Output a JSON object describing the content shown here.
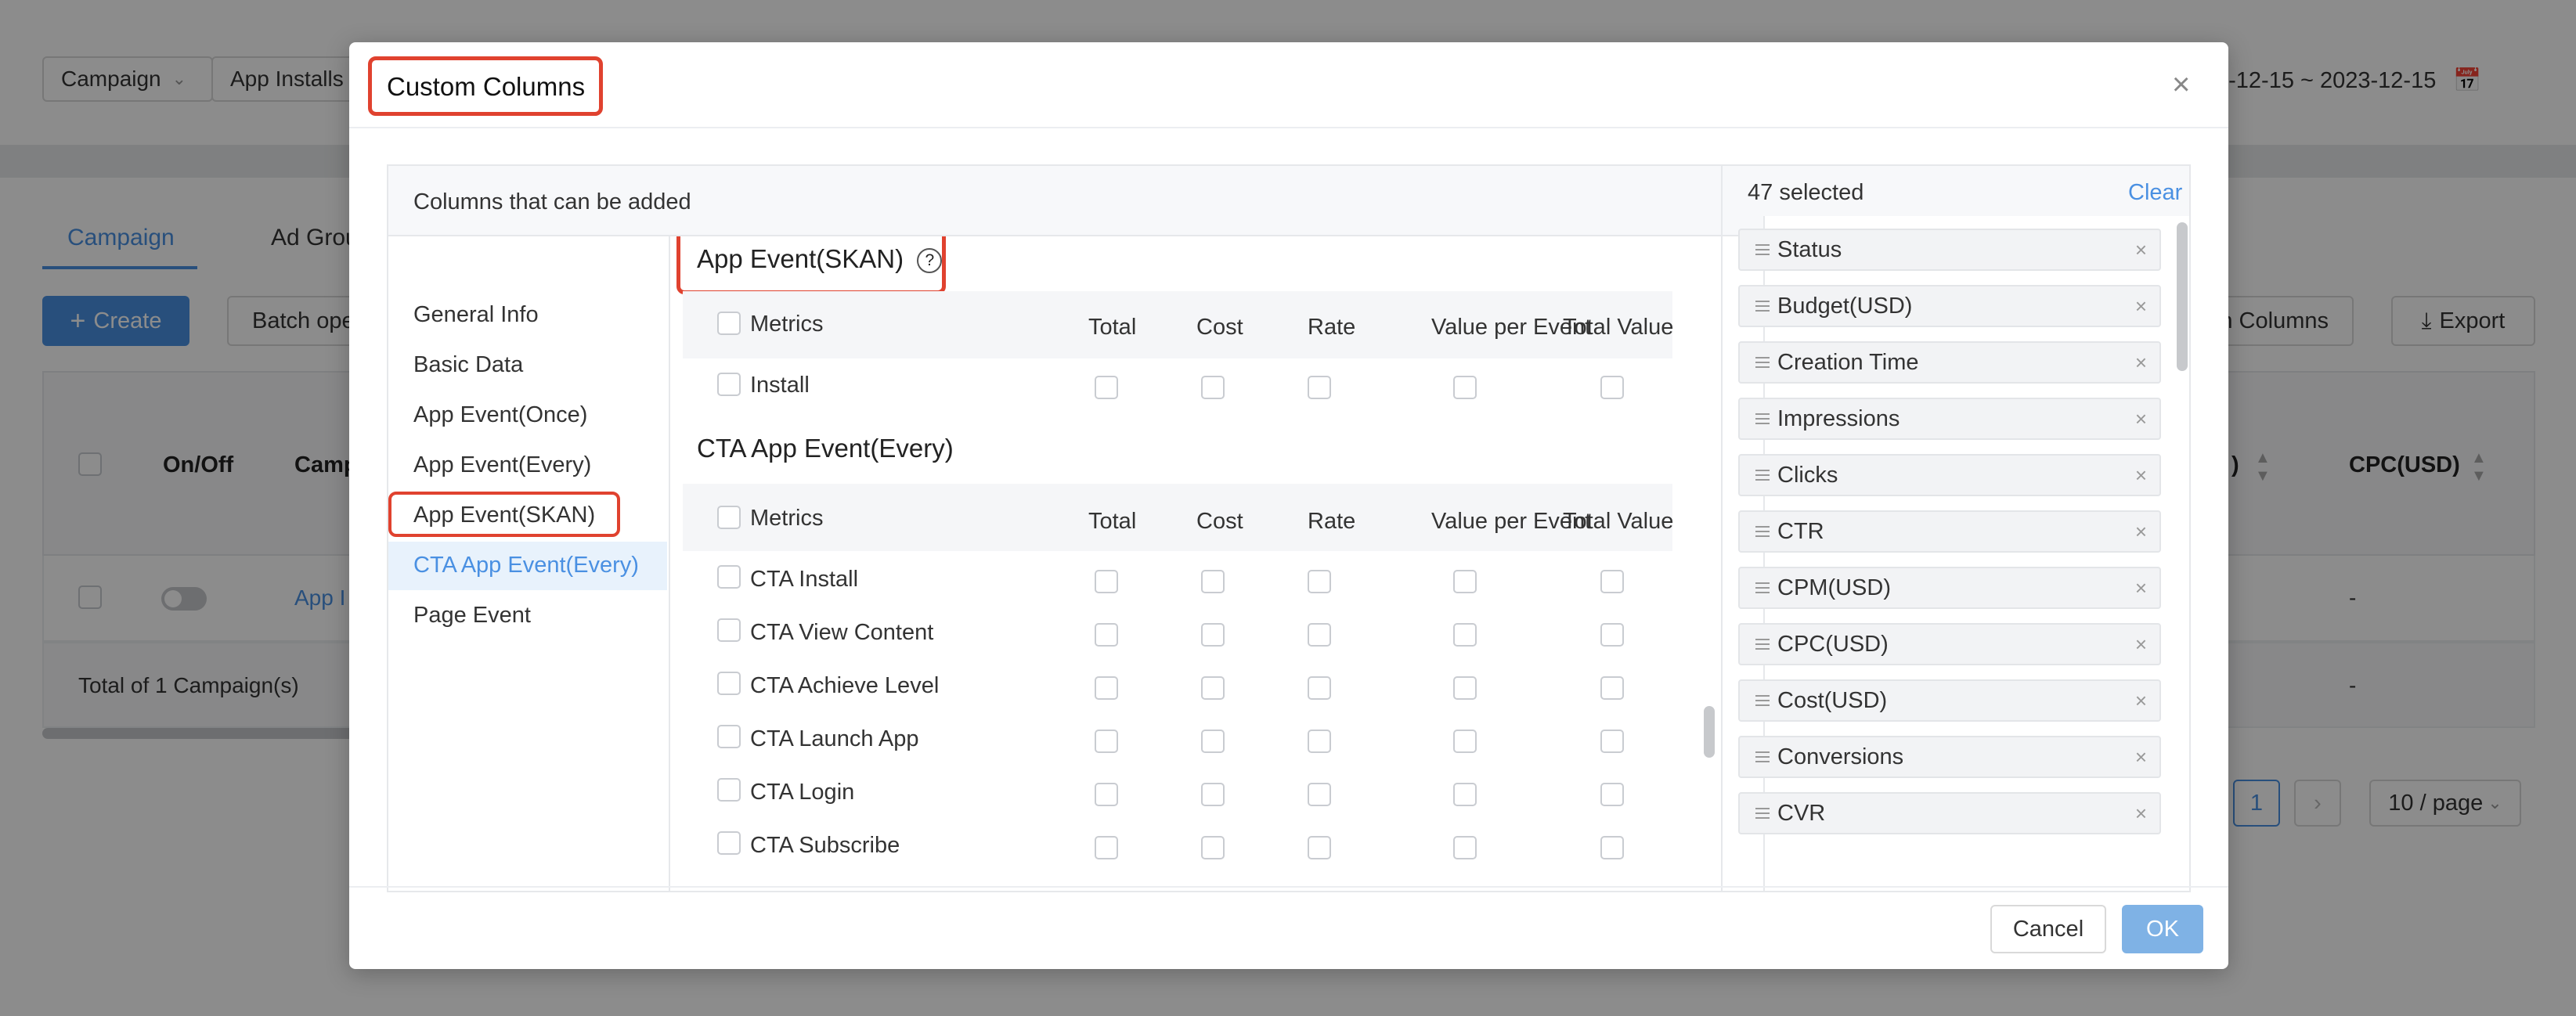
{
  "background": {
    "filter_level": "Campaign",
    "filter_objective": "App Installs",
    "date_range": "2023-12-15  ~  2023-12-15",
    "date_range_visible": "3-12-15  ~  2023-12-15",
    "tabs": [
      "Campaign",
      "Ad Grou"
    ],
    "create_label": "Create",
    "batch_label": "Batch ope",
    "custom_columns_label": "n Columns",
    "export_label": "Export",
    "table_headers": {
      "onoff": "On/Off",
      "campaign": "Camp",
      "metric": ")",
      "cpc": "CPC(USD)"
    },
    "row_link": "App I",
    "row_value": "-",
    "total_label": "Total of 1 Campaign(s)",
    "total_value": "-",
    "page_current": "1",
    "page_size": "10 / page"
  },
  "modal": {
    "title": "Custom Columns",
    "available_header": "Columns that can be added",
    "nav_items": [
      "General Info",
      "Basic Data",
      "App Event(Once)",
      "App Event(Every)",
      "App Event(SKAN)",
      "CTA App Event(Every)",
      "Page Event"
    ],
    "active_nav": "CTA App Event(Every)",
    "sections": [
      {
        "title": "App Event(SKAN)",
        "columns": [
          "Metrics",
          "Total",
          "Cost",
          "Rate",
          "Value per Event",
          "Total Value"
        ],
        "rows": [
          "Install"
        ]
      },
      {
        "title": "CTA App Event(Every)",
        "columns": [
          "Metrics",
          "Total",
          "Cost",
          "Rate",
          "Value per Event",
          "Total Value"
        ],
        "rows": [
          "CTA Install",
          "CTA View Content",
          "CTA Achieve Level",
          "CTA Launch App",
          "CTA Login",
          "CTA Subscribe"
        ]
      }
    ],
    "selected_count": "47 selected",
    "clear_label": "Clear",
    "selected_items": [
      "Status",
      "Budget(USD)",
      "Creation Time",
      "Impressions",
      "Clicks",
      "CTR",
      "CPM(USD)",
      "CPC(USD)",
      "Cost(USD)",
      "Conversions",
      "CVR"
    ],
    "cancel_label": "Cancel",
    "ok_label": "OK"
  },
  "colors": {
    "accent": "#4a90e2",
    "highlight": "#e0422f",
    "active_bg": "#e8f2fc",
    "ok_bg": "#7fb2e5"
  }
}
